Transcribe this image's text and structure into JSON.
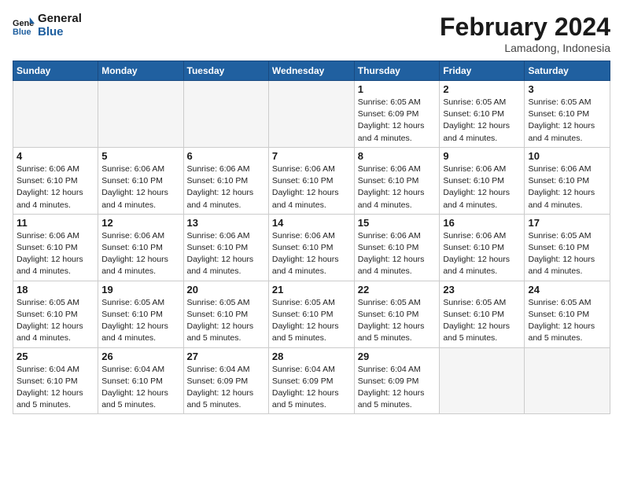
{
  "header": {
    "logo_line1": "General",
    "logo_line2": "Blue",
    "month": "February 2024",
    "location": "Lamadong, Indonesia"
  },
  "weekdays": [
    "Sunday",
    "Monday",
    "Tuesday",
    "Wednesday",
    "Thursday",
    "Friday",
    "Saturday"
  ],
  "weeks": [
    [
      {
        "day": "",
        "info": ""
      },
      {
        "day": "",
        "info": ""
      },
      {
        "day": "",
        "info": ""
      },
      {
        "day": "",
        "info": ""
      },
      {
        "day": "1",
        "info": "Sunrise: 6:05 AM\nSunset: 6:09 PM\nDaylight: 12 hours\nand 4 minutes."
      },
      {
        "day": "2",
        "info": "Sunrise: 6:05 AM\nSunset: 6:10 PM\nDaylight: 12 hours\nand 4 minutes."
      },
      {
        "day": "3",
        "info": "Sunrise: 6:05 AM\nSunset: 6:10 PM\nDaylight: 12 hours\nand 4 minutes."
      }
    ],
    [
      {
        "day": "4",
        "info": "Sunrise: 6:06 AM\nSunset: 6:10 PM\nDaylight: 12 hours\nand 4 minutes."
      },
      {
        "day": "5",
        "info": "Sunrise: 6:06 AM\nSunset: 6:10 PM\nDaylight: 12 hours\nand 4 minutes."
      },
      {
        "day": "6",
        "info": "Sunrise: 6:06 AM\nSunset: 6:10 PM\nDaylight: 12 hours\nand 4 minutes."
      },
      {
        "day": "7",
        "info": "Sunrise: 6:06 AM\nSunset: 6:10 PM\nDaylight: 12 hours\nand 4 minutes."
      },
      {
        "day": "8",
        "info": "Sunrise: 6:06 AM\nSunset: 6:10 PM\nDaylight: 12 hours\nand 4 minutes."
      },
      {
        "day": "9",
        "info": "Sunrise: 6:06 AM\nSunset: 6:10 PM\nDaylight: 12 hours\nand 4 minutes."
      },
      {
        "day": "10",
        "info": "Sunrise: 6:06 AM\nSunset: 6:10 PM\nDaylight: 12 hours\nand 4 minutes."
      }
    ],
    [
      {
        "day": "11",
        "info": "Sunrise: 6:06 AM\nSunset: 6:10 PM\nDaylight: 12 hours\nand 4 minutes."
      },
      {
        "day": "12",
        "info": "Sunrise: 6:06 AM\nSunset: 6:10 PM\nDaylight: 12 hours\nand 4 minutes."
      },
      {
        "day": "13",
        "info": "Sunrise: 6:06 AM\nSunset: 6:10 PM\nDaylight: 12 hours\nand 4 minutes."
      },
      {
        "day": "14",
        "info": "Sunrise: 6:06 AM\nSunset: 6:10 PM\nDaylight: 12 hours\nand 4 minutes."
      },
      {
        "day": "15",
        "info": "Sunrise: 6:06 AM\nSunset: 6:10 PM\nDaylight: 12 hours\nand 4 minutes."
      },
      {
        "day": "16",
        "info": "Sunrise: 6:06 AM\nSunset: 6:10 PM\nDaylight: 12 hours\nand 4 minutes."
      },
      {
        "day": "17",
        "info": "Sunrise: 6:05 AM\nSunset: 6:10 PM\nDaylight: 12 hours\nand 4 minutes."
      }
    ],
    [
      {
        "day": "18",
        "info": "Sunrise: 6:05 AM\nSunset: 6:10 PM\nDaylight: 12 hours\nand 4 minutes."
      },
      {
        "day": "19",
        "info": "Sunrise: 6:05 AM\nSunset: 6:10 PM\nDaylight: 12 hours\nand 4 minutes."
      },
      {
        "day": "20",
        "info": "Sunrise: 6:05 AM\nSunset: 6:10 PM\nDaylight: 12 hours\nand 5 minutes."
      },
      {
        "day": "21",
        "info": "Sunrise: 6:05 AM\nSunset: 6:10 PM\nDaylight: 12 hours\nand 5 minutes."
      },
      {
        "day": "22",
        "info": "Sunrise: 6:05 AM\nSunset: 6:10 PM\nDaylight: 12 hours\nand 5 minutes."
      },
      {
        "day": "23",
        "info": "Sunrise: 6:05 AM\nSunset: 6:10 PM\nDaylight: 12 hours\nand 5 minutes."
      },
      {
        "day": "24",
        "info": "Sunrise: 6:05 AM\nSunset: 6:10 PM\nDaylight: 12 hours\nand 5 minutes."
      }
    ],
    [
      {
        "day": "25",
        "info": "Sunrise: 6:04 AM\nSunset: 6:10 PM\nDaylight: 12 hours\nand 5 minutes."
      },
      {
        "day": "26",
        "info": "Sunrise: 6:04 AM\nSunset: 6:10 PM\nDaylight: 12 hours\nand 5 minutes."
      },
      {
        "day": "27",
        "info": "Sunrise: 6:04 AM\nSunset: 6:09 PM\nDaylight: 12 hours\nand 5 minutes."
      },
      {
        "day": "28",
        "info": "Sunrise: 6:04 AM\nSunset: 6:09 PM\nDaylight: 12 hours\nand 5 minutes."
      },
      {
        "day": "29",
        "info": "Sunrise: 6:04 AM\nSunset: 6:09 PM\nDaylight: 12 hours\nand 5 minutes."
      },
      {
        "day": "",
        "info": ""
      },
      {
        "day": "",
        "info": ""
      }
    ]
  ]
}
